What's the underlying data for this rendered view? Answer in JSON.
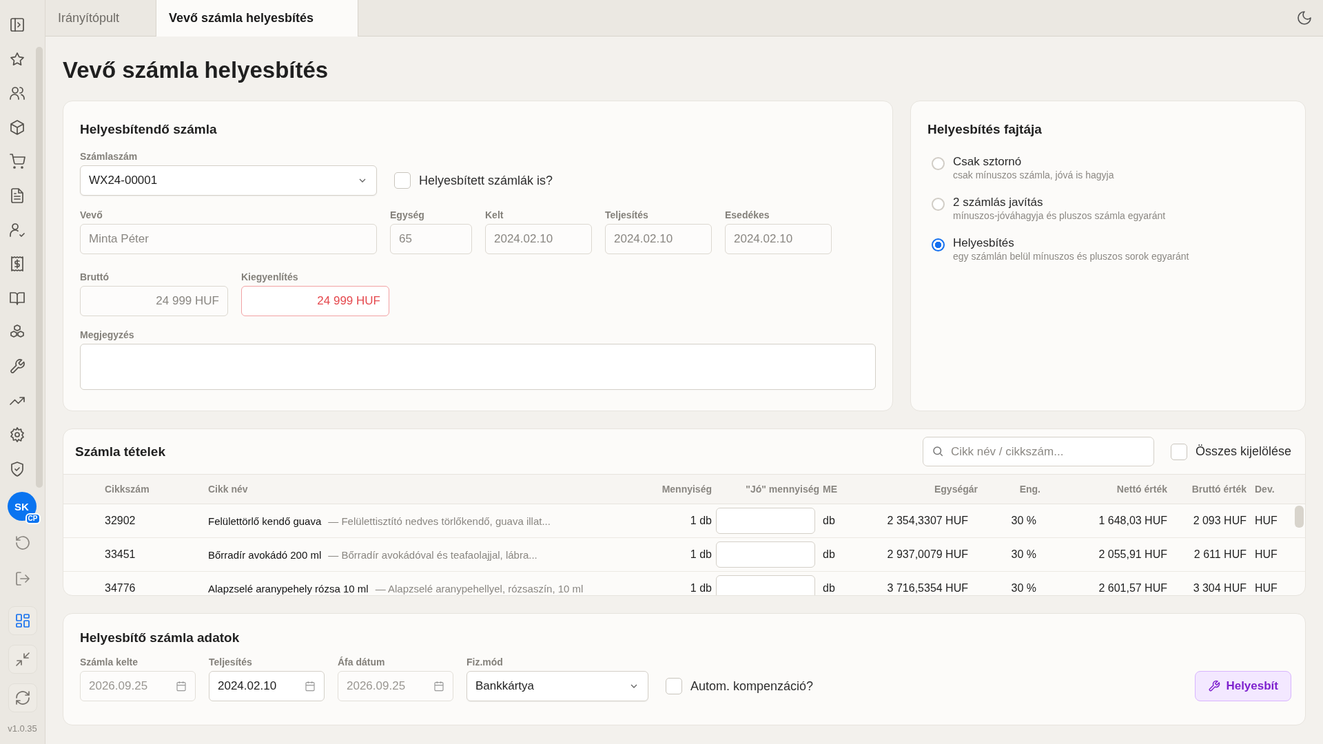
{
  "sidebar": {
    "avatar": {
      "initials": "SK",
      "badge": "CP"
    },
    "version": "v1.0.35"
  },
  "tabs": [
    {
      "label": "Irányítópult",
      "selected": false
    },
    {
      "label": "Vevő számla helyesbítés",
      "selected": true
    }
  ],
  "page_title": "Vevő számla helyesbítés",
  "invoice_panel": {
    "title": "Helyesbítendő számla",
    "invoice_number": {
      "label": "Számlaszám",
      "value": "WX24-00001"
    },
    "include_corrected": {
      "label": "Helyesbített számlák is?",
      "checked": false
    },
    "fields": [
      {
        "label": "Vevő",
        "value": "Minta Péter",
        "disabled": true,
        "kind": "wide"
      },
      {
        "label": "Egység",
        "value": "65",
        "disabled": true,
        "kind": "small"
      },
      {
        "label": "Kelt",
        "value": "2024.02.10",
        "disabled": true,
        "kind": "date"
      },
      {
        "label": "Teljesítés",
        "value": "2024.02.10",
        "disabled": true,
        "kind": "date"
      },
      {
        "label": "Esedékes",
        "value": "2024.02.10",
        "disabled": true,
        "kind": "date"
      }
    ],
    "amounts": [
      {
        "label": "Bruttó",
        "value": "24 999 HUF",
        "invalid": false
      },
      {
        "label": "Kiegyenlítés",
        "value": "24 999 HUF",
        "invalid": true
      }
    ],
    "note": {
      "label": "Megjegyzés"
    }
  },
  "correction_type": {
    "title": "Helyesbítés fajtája",
    "options": [
      {
        "label": "Csak sztornó",
        "description": "csak mínuszos számla, jóvá is hagyja",
        "selected": false
      },
      {
        "label": "2 számlás javítás",
        "description": "mínuszos-jóváhagyja és pluszos számla egyaránt",
        "selected": false
      },
      {
        "label": "Helyesbítés",
        "description": "egy számlán belül mínuszos és pluszos sorok egyaránt",
        "selected": true
      }
    ]
  },
  "items": {
    "title": "Számla tételek",
    "search": {
      "placeholder": "Cikk név / cikkszám..."
    },
    "select_all": {
      "label": "Összes kijelölése",
      "checked": false
    },
    "columns": [
      "Cikkszám",
      "Cikk név",
      "Mennyiség",
      "\"Jó\" mennyiség",
      "ME",
      "Egységár",
      "Eng.",
      "Nettó érték",
      "Bruttó érték",
      "Dev."
    ],
    "rows": [
      {
        "code": "32902",
        "name": "Felülettörlő kendő guava",
        "description": "— Felülettisztító nedves törlőkendő, guava illat...",
        "quantity": "1 db",
        "unit": "db",
        "unit_price": "2 354,3307 HUF",
        "discount": "30 %",
        "net": "1 648,03 HUF",
        "gross": "2 093 HUF",
        "currency": "HUF"
      },
      {
        "code": "33451",
        "name": "Bőrradír avokádó 200 ml",
        "description": "— Bőrradír avokádóval és teafaolajjal, lábra...",
        "quantity": "1 db",
        "unit": "db",
        "unit_price": "2 937,0079 HUF",
        "discount": "30 %",
        "net": "2 055,91 HUF",
        "gross": "2 611 HUF",
        "currency": "HUF"
      },
      {
        "code": "34776",
        "name": "Alapzselé aranypehely rózsa 10 ml",
        "description": "— Alapzselé aranypehellyel, rózsaszín, 10 ml",
        "quantity": "1 db",
        "unit": "db",
        "unit_price": "3 716,5354 HUF",
        "discount": "30 %",
        "net": "2 601,57 HUF",
        "gross": "3 304 HUF",
        "currency": "HUF"
      }
    ]
  },
  "correcting_invoice": {
    "title": "Helyesbítő számla adatok",
    "dates": [
      {
        "label": "Számla kelte",
        "value": "2026.09.25",
        "disabled": true
      },
      {
        "label": "Teljesítés",
        "value": "2024.02.10",
        "disabled": false
      },
      {
        "label": "Áfa dátum",
        "value": "2026.09.25",
        "disabled": true
      }
    ],
    "payment_method": {
      "label": "Fiz.mód",
      "value": "Bankkártya"
    },
    "auto_compensation": {
      "label": "Autom. kompenzáció?",
      "checked": false
    },
    "submit": "Helyesbít"
  }
}
